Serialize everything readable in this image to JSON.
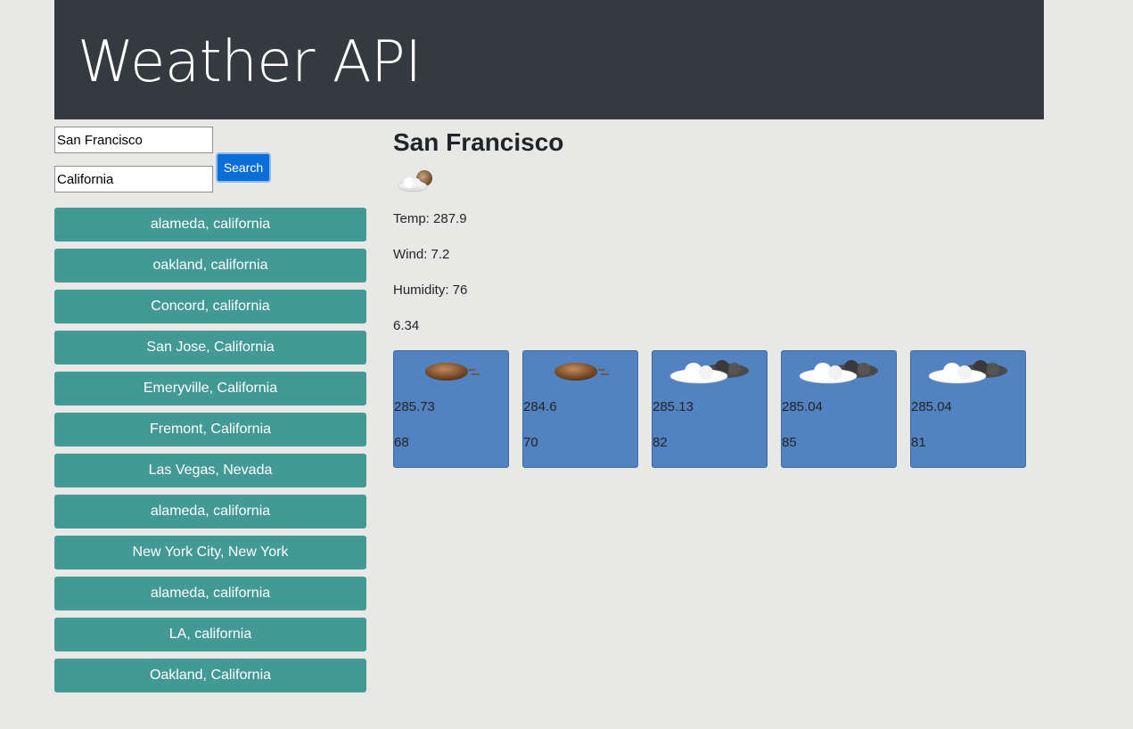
{
  "header": {
    "title": "Weather API"
  },
  "search": {
    "city_value": "San Francisco",
    "state_value": "California",
    "button_label": "Search"
  },
  "history": [
    "alameda, california",
    "oakland, california",
    "Concord, california",
    "San Jose, California",
    "Emeryville, California",
    "Fremont, California",
    "Las Vegas, Nevada",
    "alameda, california",
    "New York City, New York",
    "alameda, california",
    "LA, california",
    "Oakland, California"
  ],
  "current": {
    "city": "San Francisco",
    "icon": "partly-cloudy-night-icon",
    "temp": "Temp: 287.9",
    "wind": "Wind: 7.2",
    "humidity": "Humidity: 76",
    "uv": "6.34"
  },
  "forecast": [
    {
      "icon": "wind-icon",
      "temp": "285.73",
      "humidity": "68"
    },
    {
      "icon": "wind-icon",
      "temp": "284.6",
      "humidity": "70"
    },
    {
      "icon": "broken-clouds-icon",
      "temp": "285.13",
      "humidity": "82"
    },
    {
      "icon": "broken-clouds-icon",
      "temp": "285.04",
      "humidity": "85"
    },
    {
      "icon": "broken-clouds-icon",
      "temp": "285.04",
      "humidity": "81"
    }
  ],
  "colors": {
    "header_bg": "#343a40",
    "history_btn": "#429996",
    "search_btn": "#0a6ed8",
    "card_bg": "#5282bf",
    "page_bg": "#e8e8e6"
  }
}
